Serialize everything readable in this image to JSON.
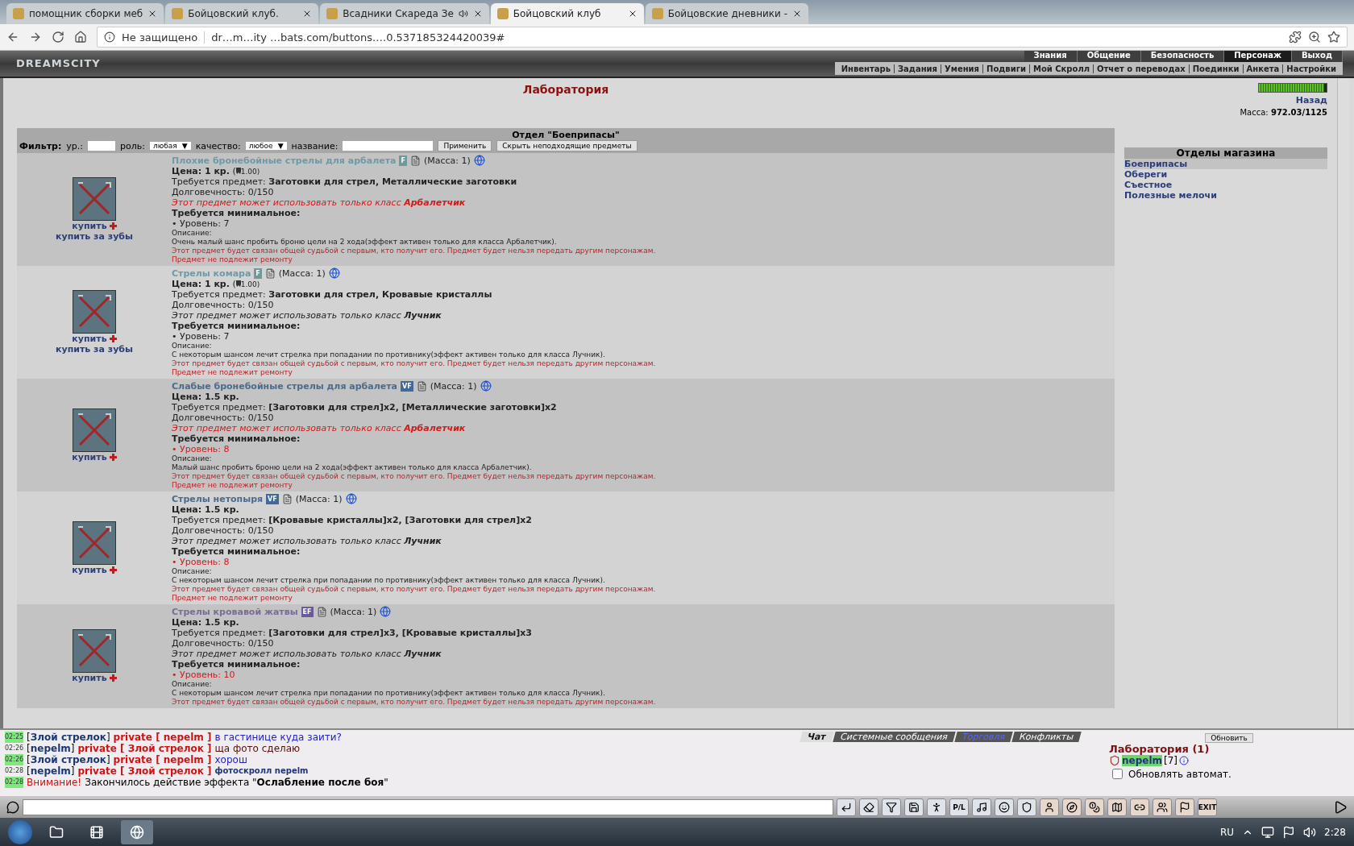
{
  "browser": {
    "tabs": [
      {
        "title": "помощник сборки меб",
        "selected": false,
        "audio": false
      },
      {
        "title": "Бойцовский клуб.",
        "selected": false,
        "audio": false
      },
      {
        "title": "Всадники Скареда Зе",
        "selected": false,
        "audio": true
      },
      {
        "title": "Бойцовский клуб",
        "selected": true,
        "audio": false
      },
      {
        "title": "Бойцовские дневники -",
        "selected": false,
        "audio": false
      }
    ],
    "security": "Не защищено",
    "url": "dr…m…ity …bats.com/buttons.…0.537185324420039#"
  },
  "header": {
    "logo": "DREAMSCITY",
    "menu": [
      {
        "label": "Знания",
        "selected": false
      },
      {
        "label": "Общение",
        "selected": false
      },
      {
        "label": "Безопасность",
        "selected": false
      },
      {
        "label": "Персонаж",
        "selected": true
      },
      {
        "label": "Выход",
        "selected": false
      }
    ],
    "submenu": [
      "Инвентарь",
      "Задания",
      "Умения",
      "Подвиги",
      "Мой Скролл",
      "Отчет о переводах",
      "Поединки",
      "Анкета",
      "Настройки"
    ]
  },
  "page": {
    "title": "Лаборатория",
    "back": "Назад",
    "hp": {
      "level": 0.97
    },
    "mass_label": "Масса:",
    "mass_value": "972.03/1125"
  },
  "department": {
    "title": "Отдел \"Боеприпасы\"",
    "filter": {
      "label": "Фильтр:",
      "level_label": "ур.:",
      "role_label": "роль:",
      "role_value": "любая",
      "role_arrow": "▼",
      "quality_arrow": "▼",
      "quality_label": "качество:",
      "quality_value": "любое",
      "name_label": "название:",
      "apply": "Применить",
      "hide": "Скрыть неподходящие предметы"
    }
  },
  "items": [
    {
      "name": "Плохие бронебойные стрелы для арбалета",
      "grade": "F",
      "mass": "(Масса: 1)",
      "price": "Цена: 1 кр.",
      "teeth_open": "(",
      "teeth": "1.00)",
      "req_label": "Требуется предмет:",
      "req": "Заготовки для стрел, Металлические заготовки",
      "durability": "Долговечность: 0/150",
      "class_text": "Этот предмет может использовать только класс **Арбалетчик**",
      "class_ok": false,
      "min_label": "Требуется минимальное:",
      "level": "• Уровень: 7",
      "level_ok": true,
      "desc_label": "Описание:",
      "desc": "Очень малый шанс пробить броню цели на 2 хода(эффект активен только для класса Арбалетчик).",
      "bind": "Этот предмет будет связан общей судьбой с первым, кто получит его. Предмет будет нельзя передать другим персонажам.",
      "repair": "Предмет не подлежит ремонту",
      "buy": "купить",
      "buy_teeth": "купить за зубы"
    },
    {
      "name": "Стрелы комара",
      "grade": "F",
      "mass": "(Масса: 1)",
      "price": "Цена: 1 кр.",
      "teeth_open": "(",
      "teeth": "1.00)",
      "req_label": "Требуется предмет:",
      "req": "Заготовки для стрел, Кровавые кристаллы",
      "durability": "Долговечность: 0/150",
      "class_text": "Этот предмет может использовать только класс **Лучник**",
      "class_ok": true,
      "min_label": "Требуется минимальное:",
      "level": "• Уровень: 7",
      "level_ok": true,
      "desc_label": "Описание:",
      "desc": "С некоторым шансом лечит стрелка при попадании по противнику(эффект активен только для класса Лучник).",
      "bind": "Этот предмет будет связан общей судьбой с первым, кто получит его. Предмет будет нельзя передать другим персонажам.",
      "repair": "Предмет не подлежит ремонту",
      "buy": "купить",
      "buy_teeth": "купить за зубы"
    },
    {
      "name": "Слабые бронебойные стрелы для арбалета",
      "grade": "VF",
      "mass": "(Масса: 1)",
      "price": "Цена: 1.5 кр.",
      "req_label": "Требуется предмет:",
      "req": "[Заготовки для стрел]x2, [Металлические заготовки]x2",
      "durability": "Долговечность: 0/150",
      "class_text": "Этот предмет может использовать только класс **Арбалетчик**",
      "class_ok": false,
      "min_label": "Требуется минимальное:",
      "level": "• Уровень: 8",
      "level_ok": false,
      "desc_label": "Описание:",
      "desc": "Малый шанс пробить броню цели на 2 хода(эффект активен только для класса Арбалетчик).",
      "bind": "Этот предмет будет связан общей судьбой с первым, кто получит его. Предмет будет нельзя передать другим персонажам.",
      "repair": "Предмет не подлежит ремонту",
      "buy": "купить"
    },
    {
      "name": "Стрелы нетопыря",
      "grade": "VF",
      "mass": "(Масса: 1)",
      "price": "Цена: 1.5 кр.",
      "req_label": "Требуется предмет:",
      "req": "[Кровавые кристаллы]x2, [Заготовки для стрел]x2",
      "durability": "Долговечность: 0/150",
      "class_text": "Этот предмет может использовать только класс **Лучник**",
      "class_ok": true,
      "min_label": "Требуется минимальное:",
      "level": "• Уровень: 8",
      "level_ok": false,
      "desc_label": "Описание:",
      "desc": "С некоторым шансом лечит стрелка при попадании по противнику(эффект активен только для класса Лучник).",
      "bind": "Этот предмет будет связан общей судьбой с первым, кто получит его. Предмет будет нельзя передать другим персонажам.",
      "repair": "Предмет не подлежит ремонту",
      "buy": "купить"
    },
    {
      "name": "Стрелы кровавой жатвы",
      "grade": "EF",
      "mass": "(Масса: 1)",
      "price": "Цена: 1.5 кр.",
      "req_label": "Требуется предмет:",
      "req": "[Заготовки для стрел]x3, [Кровавые кристаллы]x3",
      "durability": "Долговечность: 0/150",
      "class_text": "Этот предмет может использовать только класс **Лучник**",
      "class_ok": true,
      "min_label": "Требуется минимальное:",
      "level": "• Уровень: 10",
      "level_ok": false,
      "desc_label": "Описание:",
      "desc": "С некоторым шансом лечит стрелка при попадании по противнику(эффект активен только для класса Лучник).",
      "bind": "Этот предмет будет связан общей судьбой с первым, кто получит его. Предмет будет нельзя передать другим персонажам.",
      "buy": "купить"
    }
  ],
  "shop": {
    "title": "Отделы магазина",
    "departments": [
      {
        "label": "Боеприпасы",
        "selected": true
      },
      {
        "label": "Обереги",
        "selected": false
      },
      {
        "label": "Съестное",
        "selected": false
      },
      {
        "label": "Полезные мелочи",
        "selected": false
      }
    ]
  },
  "chat": {
    "tabs": [
      {
        "label": "Чат",
        "selected": true,
        "highlight": false
      },
      {
        "label": "Системные сообщения",
        "selected": false,
        "highlight": false
      },
      {
        "label": "Торговля",
        "selected": false,
        "highlight": true
      },
      {
        "label": "Конфликты",
        "selected": false,
        "highlight": false
      }
    ],
    "lines": [
      {
        "kind": "incoming",
        "time": "02:25",
        "highlighted": true,
        "sender": "[**Злой стрелок**]",
        "private": "private [ nepelm ]",
        "text": "в гастинице куда заити?"
      },
      {
        "kind": "outgoing",
        "time": "02:26",
        "highlighted": false,
        "sender": "[**nepelm**]",
        "private": "private [ Злой стрелок ]",
        "text": "ща фото сделаю"
      },
      {
        "kind": "incoming",
        "time": "02:26",
        "highlighted": true,
        "sender": "[**Злой стрелок**]",
        "private": "private [ nepelm ]",
        "text": "хорош"
      },
      {
        "kind": "scroll",
        "time": "02:28",
        "highlighted": false,
        "sender": "[**nepelm**]",
        "private": "private [ Злой стрелок ]",
        "text": "фотоскролл nepelm"
      },
      {
        "kind": "system",
        "time": "02:28",
        "highlighted": true,
        "label": "Внимание!",
        "text": "Закончилось действие эффекта \"**Ослабление после боя**\""
      }
    ]
  },
  "online": {
    "refresh": "Обновить",
    "room": "Лаборатория (1)",
    "user": "nepelm",
    "user_level": "[7]",
    "auto_label": "Обновлять автомат.",
    "auto_checked": false
  },
  "toolbar": {
    "pl": "P/L",
    "exit": "EXIT"
  },
  "taskbar": {
    "lang": "RU",
    "time": "2:28"
  }
}
